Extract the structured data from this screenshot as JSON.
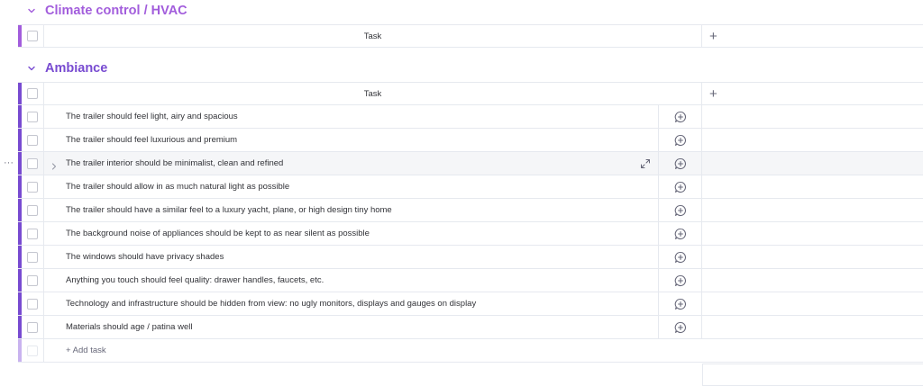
{
  "groups": [
    {
      "title": "Climate control / HVAC",
      "color": "#a25ddc",
      "column_header": "Task",
      "add_column_label": "+"
    },
    {
      "title": "Ambiance",
      "color": "#784bd1",
      "column_header": "Task",
      "add_column_label": "+",
      "items": [
        "The trailer should feel light, airy and spacious",
        "The trailer should feel luxurious and premium",
        "The trailer interior should be minimalist, clean and refined",
        "The trailer should allow in as much natural light as possible",
        "The trailer should have a similar feel to a luxury yacht, plane, or high design tiny home",
        "The background noise of appliances should be kept to as near silent as possible",
        "The windows should have privacy shades",
        "Anything you touch should feel quality: drawer handles, faucets, etc.",
        "Technology and infrastructure should be hidden from view: no ugly monitors, displays and gauges on display",
        "Materials should age / patina well"
      ],
      "add_item_label": "+ Add task"
    }
  ],
  "row_menu": "···",
  "icons": {
    "chevron": "chevron-down-icon",
    "conversation": "add-update-icon",
    "expand": "expand-icon"
  }
}
